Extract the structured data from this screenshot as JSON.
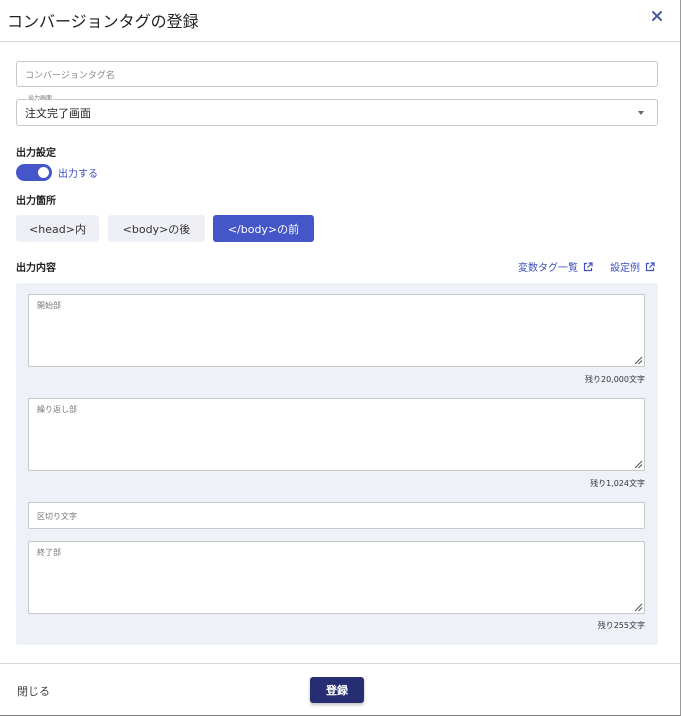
{
  "dialog": {
    "title": "コンバージョンタグの登録",
    "close_icon": "close-icon"
  },
  "form": {
    "name_placeholder": "コンバージョンタグ名",
    "screen_label": "出力画面",
    "screen_value": "注文完了画面"
  },
  "output_setting": {
    "label": "出力設定",
    "toggle_text": "出力する",
    "toggle_on": true
  },
  "output_location": {
    "label": "出力箇所",
    "options": [
      "<head>内",
      "<body>の後",
      "</body>の前"
    ],
    "selected": "</body>の前"
  },
  "output_content": {
    "label": "出力内容",
    "links": [
      "変数タグ一覧",
      "設定例"
    ],
    "fields": [
      {
        "label": "開始部",
        "remaining": "残り20,000文字"
      },
      {
        "label": "繰り返し部",
        "remaining": "残り1,024文字"
      },
      {
        "label": "区切り文字"
      },
      {
        "label": "終了部",
        "remaining": "残り255文字"
      }
    ]
  },
  "footer": {
    "close_label": "閉じる",
    "submit_label": "登録"
  },
  "colors": {
    "accent": "#4456c8",
    "submit": "#262d72",
    "panel": "#eef1f8"
  }
}
